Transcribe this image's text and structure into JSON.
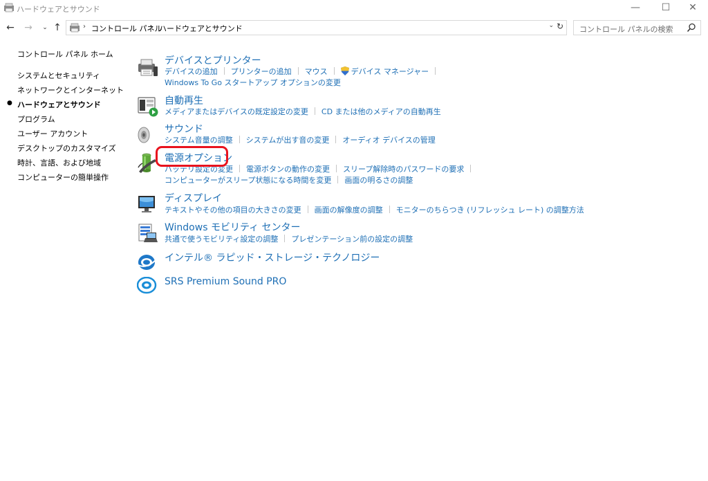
{
  "window": {
    "title": "ハードウェアとサウンド",
    "minimize": "—",
    "maximize": "☐",
    "close": "✕"
  },
  "nav": {
    "back": "←",
    "forward": "→",
    "recent": "⌄",
    "up": "↑",
    "breadcrumb": [
      "コントロール パネル",
      "ハードウェアとサウンド"
    ],
    "refresh": "↻",
    "search_placeholder": "コントロール パネルの検索"
  },
  "sidebar": {
    "home": "コントロール パネル ホーム",
    "items": [
      {
        "label": "システムとセキュリティ",
        "active": false
      },
      {
        "label": "ネットワークとインターネット",
        "active": false
      },
      {
        "label": "ハードウェアとサウンド",
        "active": true
      },
      {
        "label": "プログラム",
        "active": false
      },
      {
        "label": "ユーザー アカウント",
        "active": false
      },
      {
        "label": "デスクトップのカスタマイズ",
        "active": false
      },
      {
        "label": "時計、言語、および地域",
        "active": false
      },
      {
        "label": "コンピューターの簡単操作",
        "active": false
      }
    ],
    "bullet": "●"
  },
  "categories": {
    "devices": {
      "title": "デバイスとプリンター",
      "links_row1": [
        "デバイスの追加",
        "プリンターの追加",
        "マウス",
        "デバイス マネージャー"
      ],
      "links_row2": [
        "Windows To Go スタートアップ オプションの変更"
      ],
      "icon": "printer-icon"
    },
    "autoplay": {
      "title": "自動再生",
      "links_row1": [
        "メディアまたはデバイスの既定設定の変更",
        "CD または他のメディアの自動再生"
      ],
      "icon": "autoplay-icon"
    },
    "sound": {
      "title": "サウンド",
      "links_row1": [
        "システム音量の調整",
        "システムが出す音の変更",
        "オーディオ デバイスの管理"
      ],
      "icon": "speaker-icon"
    },
    "power": {
      "title": "電源オプション",
      "links_row1": [
        "バッテリ設定の変更",
        "電源ボタンの動作の変更",
        "スリープ解除時のパスワードの要求"
      ],
      "links_row2": [
        "コンピューターがスリープ状態になる時間を変更",
        "画面の明るさの調整"
      ],
      "icon": "battery-icon"
    },
    "display": {
      "title": "ディスプレイ",
      "links_row1": [
        "テキストやその他の項目の大きさの変更",
        "画面の解像度の調整",
        "モニターのちらつき (リフレッシュ レート) の調整方法"
      ],
      "icon": "monitor-icon"
    },
    "mobility": {
      "title": "Windows モビリティ センター",
      "links_row1": [
        "共通で使うモビリティ設定の調整",
        "プレゼンテーション前の設定の調整"
      ],
      "icon": "mobility-center-icon"
    },
    "intel": {
      "title": "インテル® ラピッド・ストレージ・テクノロジー",
      "icon": "intel-rst-icon"
    },
    "srs": {
      "title": "SRS Premium Sound PRO",
      "icon": "srs-icon"
    }
  },
  "colors": {
    "link": "#1e6fb5",
    "highlight": "#e8121d"
  }
}
